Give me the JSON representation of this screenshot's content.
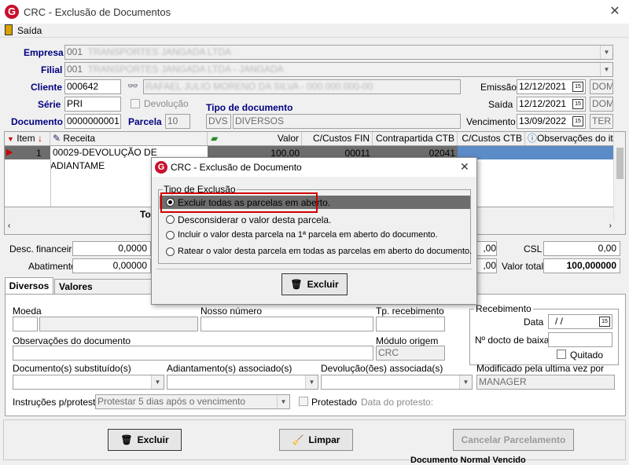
{
  "window": {
    "title": "CRC - Exclusão de Documentos"
  },
  "menu": {
    "exit_label": "Saída"
  },
  "header": {
    "empresa_label": "Empresa",
    "empresa_value": "001",
    "empresa_name": "TRANSPORTES JANGADA LTDA",
    "filial_label": "Filial",
    "filial_value": "001",
    "filial_name": "TRANSPORTES JANGADA LTDA - JANGADA",
    "cliente_label": "Cliente",
    "cliente_value": "000642",
    "cliente_name": "RAFAEL JULIO MORENO DA SILVA - 000.000.000-00",
    "serie_label": "Série",
    "serie_value": "PRI",
    "devolucao_label": "Devolução",
    "documento_label": "Documento",
    "documento_value": "0000000001",
    "parcela_label": "Parcela",
    "parcela_value": "10",
    "tipo_label": "Tipo de documento",
    "tipo_code": "DVS",
    "tipo_name": "DIVERSOS",
    "emissao_label": "Emissão",
    "emissao_value": "12/12/2021",
    "emissao_day": "DOM",
    "saida_label": "Saída",
    "saida_value": "12/12/2021",
    "saida_day": "DOM",
    "vencimento_label": "Vencimento",
    "vencimento_value": "13/09/2022",
    "vencimento_day": "TER"
  },
  "grid": {
    "headers": [
      "Item",
      "Receita",
      "Valor",
      "C/Custos FIN",
      "Contrapartida CTB",
      "C/Custos CTB",
      "Observações do it"
    ],
    "row": {
      "item": "1",
      "receita": "00029-DEVOLUÇÃO DE ADIANTAME",
      "valor": "100,00",
      "ccfin": "00011",
      "contrapartida": "02041"
    },
    "total_label": "To"
  },
  "totals": {
    "desc_label": "Desc. financeiro",
    "desc_value": "0,0000",
    "abat_label": "Abatimento",
    "abat_value": "0,00000",
    "right_small1": ",00",
    "right_small2": ",00",
    "csl_label": "CSL",
    "csl_value": "0,00",
    "valor_total_label": "Valor total",
    "valor_total_value": "100,000000"
  },
  "tabs": {
    "diversos": "Diversos",
    "valores": "Valores complementa"
  },
  "form": {
    "moeda_label": "Moeda",
    "nosso_numero_label": "Nosso número",
    "tp_recebimento_label": "Tp. recebimento",
    "recebimento_title": "Recebimento",
    "data_label": "Data",
    "data_value": "/ /",
    "ndocto_label": "Nº docto de baixa",
    "quitado_label": "Quitado",
    "obs_label": "Observações do documento",
    "modulo_label": "Módulo origem",
    "modulo_value": "CRC",
    "doc_subst_label": "Documento(s) substituído(s)",
    "adiant_label": "Adiantamento(s) associado(s)",
    "devol_label": "Devolução(ões) associada(s)",
    "modificado_label": "Modificado pela ultima vez por",
    "modificado_value": "MANAGER",
    "instr_label": "Instruções p/protesto",
    "instr_value": "Protestar 5 dias após o vencimento",
    "protestado_label": "Protestado",
    "data_protesto_label": "Data do protesto:"
  },
  "footer": {
    "excluir": "Excluir",
    "limpar": "Limpar",
    "cancelar": "Cancelar Parcelamento",
    "status_text": "Documento Normal  Vencido"
  },
  "dialog": {
    "title": "CRC - Exclusão de Documento",
    "group_title": "Tipo de Exclusão",
    "options": [
      "Excluir todas as parcelas em aberto.",
      "Desconsiderar o valor desta  parcela.",
      "Incluir o valor desta parcela na 1ª parcela em aberto do documento.",
      "Ratear o valor desta parcela em todas as parcelas em aberto do documento."
    ],
    "selected": 0,
    "excluir": "Excluir"
  },
  "colors": {
    "label_blue": "#000080",
    "highlight_red": "#d00000",
    "selected_row": "#6d6d6d",
    "brand_red": "#c8102e"
  }
}
